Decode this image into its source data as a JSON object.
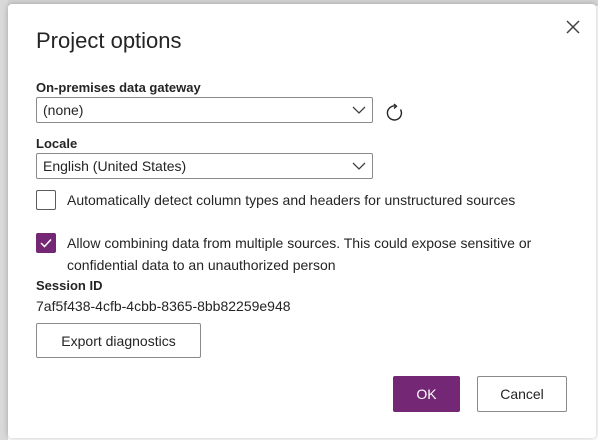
{
  "dialog": {
    "title": "Project options"
  },
  "gateway": {
    "label": "On-premises data gateway",
    "value": "(none)"
  },
  "locale": {
    "label": "Locale",
    "value": "English (United States)"
  },
  "options": {
    "auto_detect": {
      "label": "Automatically detect column types and headers for unstructured sources",
      "checked": false
    },
    "allow_combining": {
      "label": "Allow combining data from multiple sources. This could expose sensitive or confidential data to an unauthorized person",
      "checked": true
    }
  },
  "session": {
    "label": "Session ID",
    "value": "7af5f438-4cfb-4cbb-8365-8bb82259e948"
  },
  "buttons": {
    "export_label": "Export diagnostics",
    "ok_label": "OK",
    "cancel_label": "Cancel"
  },
  "colors": {
    "accent": "#742774"
  },
  "icons": {
    "close": "close-icon",
    "chevron": "chevron-down-icon",
    "refresh": "refresh-icon",
    "check": "checkmark-icon"
  }
}
